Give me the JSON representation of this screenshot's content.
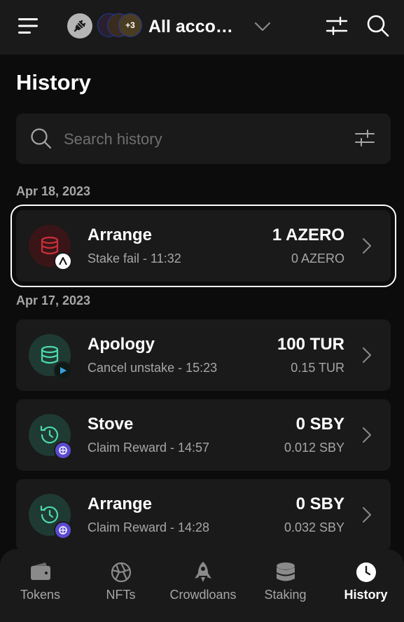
{
  "header": {
    "account_name": "All accou...",
    "avatars_more": "+3"
  },
  "page": {
    "title": "History"
  },
  "search": {
    "placeholder": "Search history"
  },
  "groups": [
    {
      "date": "Apr 18, 2023",
      "items": [
        {
          "name": "Arrange",
          "subtitle": "Stake fail - 11:32",
          "amount": "1 AZERO",
          "fee": "0 AZERO",
          "icon": "database-icon",
          "status": "fail",
          "network_icon": "aleph-zero-icon",
          "selected": true
        }
      ]
    },
    {
      "date": "Apr 17, 2023",
      "items": [
        {
          "name": "Apology",
          "subtitle": "Cancel unstake - 15:23",
          "amount": "100 TUR",
          "fee": "0.15 TUR",
          "icon": "database-icon",
          "status": "ok",
          "network_icon": "turing-icon"
        },
        {
          "name": "Stove",
          "subtitle": "Claim Reward - 14:57",
          "amount": "0 SBY",
          "fee": "0.012 SBY",
          "icon": "history-icon",
          "status": "ok",
          "network_icon": "shibuya-icon"
        },
        {
          "name": "Arrange",
          "subtitle": "Claim Reward - 14:28",
          "amount": "0 SBY",
          "fee": "0.032 SBY",
          "icon": "history-icon",
          "status": "ok",
          "network_icon": "shibuya-icon"
        }
      ]
    }
  ],
  "nav": [
    {
      "label": "Tokens",
      "icon": "wallet-icon"
    },
    {
      "label": "NFTs",
      "icon": "aperture-icon"
    },
    {
      "label": "Crowdloans",
      "icon": "rocket-icon"
    },
    {
      "label": "Staking",
      "icon": "database-icon"
    },
    {
      "label": "History",
      "icon": "clock-icon",
      "active": true
    }
  ],
  "colors": {
    "background": "#0c0c0c",
    "surface": "#1a1a1a",
    "fail": "#c8303a",
    "success": "#4cd9ac",
    "muted_text": "#a6a6a6"
  }
}
